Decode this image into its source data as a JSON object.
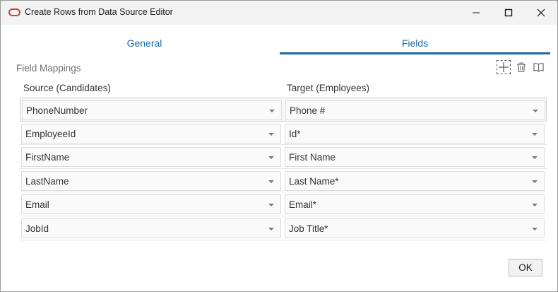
{
  "window": {
    "title": "Create Rows from Data Source Editor"
  },
  "tabs": [
    {
      "label": "General"
    },
    {
      "label": "Fields"
    }
  ],
  "section": {
    "label": "Field Mappings"
  },
  "toolbar": {
    "add_icon": "plus-icon",
    "delete_icon": "trash-icon",
    "help_icon": "book-icon"
  },
  "columns": {
    "source": "Source (Candidates)",
    "target": "Target (Employees)"
  },
  "mappings": [
    {
      "source": "PhoneNumber",
      "target": "Phone #"
    },
    {
      "source": "EmployeeId",
      "target": "Id*"
    },
    {
      "source": "FirstName",
      "target": "First Name"
    },
    {
      "source": "LastName",
      "target": "Last Name*"
    },
    {
      "source": "Email",
      "target": "Email*"
    },
    {
      "source": "JobId",
      "target": "Job Title*"
    }
  ],
  "footer": {
    "ok_label": "OK"
  },
  "colors": {
    "accent": "#1b6aa7",
    "brand": "#c74634"
  }
}
